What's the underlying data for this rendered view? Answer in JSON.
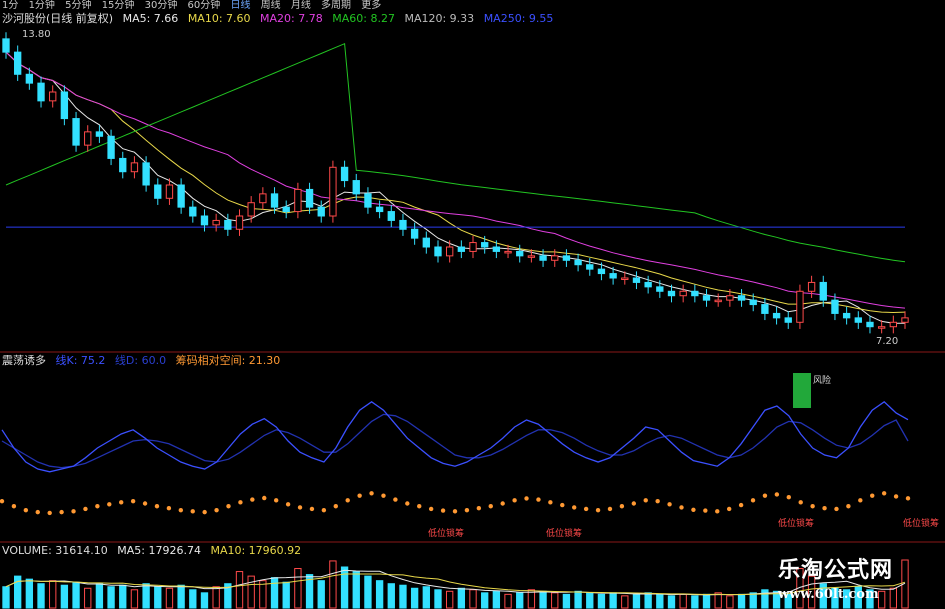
{
  "timeframes": [
    "1分",
    "1分钟",
    "5分钟",
    "15分钟",
    "30分钟",
    "60分钟",
    "日线",
    "周线",
    "月线",
    "多周期",
    "更多"
  ],
  "main_header": {
    "stock": "沙河股份(日线 前复权)",
    "ma5": "MA5: 7.66",
    "ma10": "MA10: 7.60",
    "ma20": "MA20: 7.78",
    "ma60": "MA60: 8.27",
    "ma120": "MA120: 9.33",
    "ma250": "MA250: 9.55"
  },
  "indicator_header": {
    "name": "震荡诱多",
    "a": "线K: 75.2",
    "b": "线D: 60.0",
    "c": "筹码相对空间: 21.30"
  },
  "volume_header": {
    "name": "VOLUME: 31614.10",
    "ma5": "MA5: 17926.74",
    "ma10": "MA10: 17960.92"
  },
  "price_high_label": "13.80",
  "price_low_label": "7.20",
  "signal_labels": {
    "risk": "风险",
    "low": "低位锁筹"
  },
  "watermark": {
    "line1": "乐淘公式网",
    "line2": "www.60lt.com"
  },
  "colors": {
    "up": "#ff4a4a",
    "down": "#33e0ff",
    "ma5": "#e8e8e8",
    "ma10": "#e8d84a",
    "ma20": "#e040e0",
    "ma60": "#22c422",
    "ma250": "#2b3df0",
    "dots": "#ff9933",
    "risk": "#22a83a",
    "k": "#3b50ff",
    "d": "#2232b0"
  },
  "chart_data": {
    "type": "candlestick",
    "ylim": [
      7.0,
      14.0
    ],
    "close": [
      13.5,
      13.0,
      12.8,
      12.4,
      12.6,
      12.0,
      11.4,
      11.7,
      11.6,
      11.1,
      10.8,
      11.0,
      10.5,
      10.2,
      10.5,
      10.0,
      9.8,
      9.6,
      9.7,
      9.5,
      9.8,
      10.1,
      10.3,
      10.0,
      9.9,
      10.4,
      10.0,
      9.8,
      10.9,
      10.6,
      10.3,
      10.0,
      9.9,
      9.7,
      9.5,
      9.3,
      9.1,
      8.9,
      9.1,
      9.0,
      9.2,
      9.1,
      9.0,
      9.0,
      8.9,
      8.9,
      8.8,
      8.9,
      8.8,
      8.7,
      8.6,
      8.5,
      8.4,
      8.4,
      8.3,
      8.2,
      8.1,
      8.0,
      8.1,
      8.0,
      7.9,
      7.9,
      8.0,
      7.9,
      7.8,
      7.6,
      7.5,
      7.4,
      8.1,
      8.3,
      7.9,
      7.6,
      7.5,
      7.4,
      7.3,
      7.3,
      7.4,
      7.5
    ],
    "k_line": [
      68,
      55,
      45,
      40,
      38,
      40,
      42,
      48,
      55,
      60,
      65,
      68,
      62,
      55,
      50,
      45,
      42,
      40,
      45,
      55,
      65,
      72,
      76,
      70,
      60,
      52,
      48,
      45,
      55,
      70,
      82,
      88,
      82,
      72,
      62,
      55,
      48,
      44,
      42,
      45,
      50,
      55,
      62,
      70,
      75,
      72,
      65,
      58,
      52,
      48,
      45,
      48,
      55,
      62,
      70,
      68,
      60,
      52,
      46,
      44,
      42,
      48,
      58,
      70,
      82,
      85,
      78,
      65,
      55,
      50,
      48,
      55,
      70,
      82,
      88,
      80,
      75.2
    ],
    "d_line": [
      60,
      55,
      50,
      45,
      42,
      41,
      42,
      44,
      48,
      52,
      56,
      60,
      61,
      60,
      58,
      54,
      50,
      46,
      45,
      47,
      52,
      58,
      64,
      68,
      66,
      62,
      57,
      52,
      52,
      58,
      66,
      74,
      79,
      78,
      74,
      68,
      62,
      56,
      50,
      48,
      48,
      50,
      54,
      59,
      64,
      68,
      68,
      66,
      62,
      57,
      53,
      50,
      50,
      53,
      58,
      62,
      64,
      62,
      58,
      54,
      50,
      48,
      50,
      55,
      62,
      70,
      74,
      73,
      68,
      62,
      57,
      55,
      58,
      64,
      71,
      75,
      60.0
    ],
    "volume": [
      14000,
      21000,
      19000,
      16000,
      18000,
      15000,
      17000,
      13000,
      16000,
      14000,
      15000,
      12000,
      16000,
      14000,
      13000,
      15000,
      12000,
      10000,
      14000,
      16000,
      24000,
      21000,
      18000,
      20000,
      17000,
      26000,
      22000,
      18000,
      31000,
      27000,
      24000,
      21000,
      18000,
      16000,
      15000,
      13000,
      14000,
      12000,
      11000,
      13000,
      12000,
      10000,
      11000,
      9000,
      10000,
      12000,
      11000,
      10000,
      9000,
      11000,
      10000,
      9000,
      10000,
      8000,
      9000,
      10000,
      9000,
      8000,
      9000,
      8000,
      9000,
      10000,
      8000,
      9000,
      10000,
      12000,
      11000,
      9000,
      26000,
      21000,
      16000,
      13000,
      12000,
      14000,
      12000,
      11000,
      13000,
      31614
    ]
  }
}
